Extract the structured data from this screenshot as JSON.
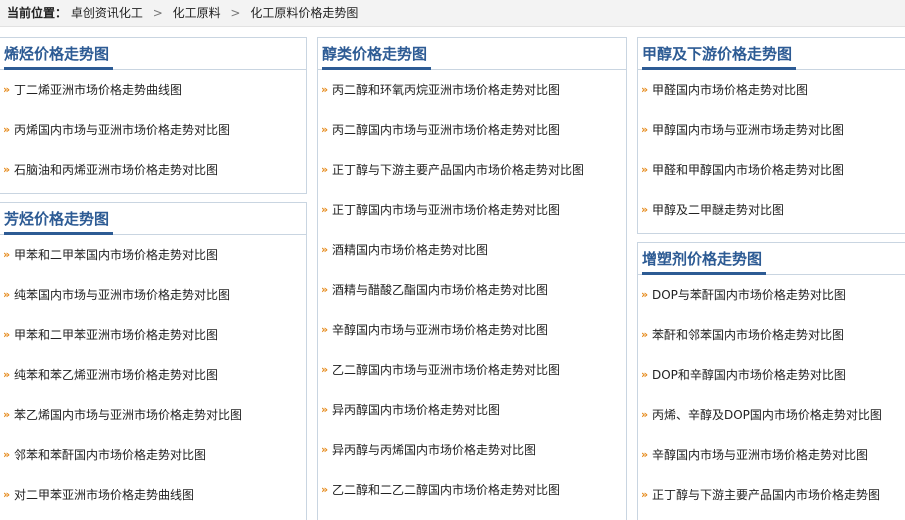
{
  "breadcrumb": {
    "prefix": "当前位置：",
    "links": [
      "卓创资讯化工",
      "化工原料",
      "化工原料价格走势图"
    ],
    "separator": ">"
  },
  "bullet": "»",
  "colors": {
    "title": "#2d5b94",
    "bullet": "#e68a1a",
    "border": "#c9d5e1"
  },
  "sections": {
    "olefins": {
      "title": "烯烃价格走势图",
      "items": [
        "丁二烯亚洲市场价格走势曲线图",
        "丙烯国内市场与亚洲市场价格走势对比图",
        "石脑油和丙烯亚洲市场价格走势对比图"
      ]
    },
    "aromatics": {
      "title": "芳烃价格走势图",
      "items": [
        "甲苯和二甲苯国内市场价格走势对比图",
        "纯苯国内市场与亚洲市场价格走势对比图",
        "甲苯和二甲苯亚洲市场价格走势对比图",
        "纯苯和苯乙烯亚洲市场价格走势对比图",
        "苯乙烯国内市场与亚洲市场价格走势对比图",
        "邻苯和苯酐国内市场价格走势对比图",
        "对二甲苯亚洲市场价格走势曲线图"
      ]
    },
    "alcohols": {
      "title": "醇类价格走势图",
      "items": [
        "丙二醇和环氧丙烷亚洲市场价格走势对比图",
        "丙二醇国内市场与亚洲市场价格走势对比图",
        "正丁醇与下游主要产品国内市场价格走势对比图",
        "正丁醇国内市场与亚洲市场价格走势对比图",
        "酒精国内市场价格走势对比图",
        "酒精与醋酸乙酯国内市场价格走势对比图",
        "辛醇国内市场与亚洲市场价格走势对比图",
        "乙二醇国内市场与亚洲市场价格走势对比图",
        "异丙醇国内市场价格走势对比图",
        "异丙醇与丙烯国内市场价格走势对比图",
        "乙二醇和二乙二醇国内市场价格走势对比图"
      ]
    },
    "methanol": {
      "title": "甲醇及下游价格走势图",
      "items": [
        "甲醛国内市场价格走势对比图",
        "甲醇国内市场与亚洲市场走势对比图",
        "甲醛和甲醇国内市场价格走势对比图",
        "甲醇及二甲醚走势对比图"
      ]
    },
    "plasticizers": {
      "title": "增塑剂价格走势图",
      "items": [
        "DOP与苯酐国内市场价格走势对比图",
        "苯酐和邻苯国内市场价格走势对比图",
        "DOP和辛醇国内市场价格走势对比图",
        "丙烯、辛醇及DOP国内市场价格走势对比图",
        "辛醇国内市场与亚洲市场价格走势对比图",
        "正丁醇与下游主要产品国内市场价格走势图"
      ]
    }
  }
}
